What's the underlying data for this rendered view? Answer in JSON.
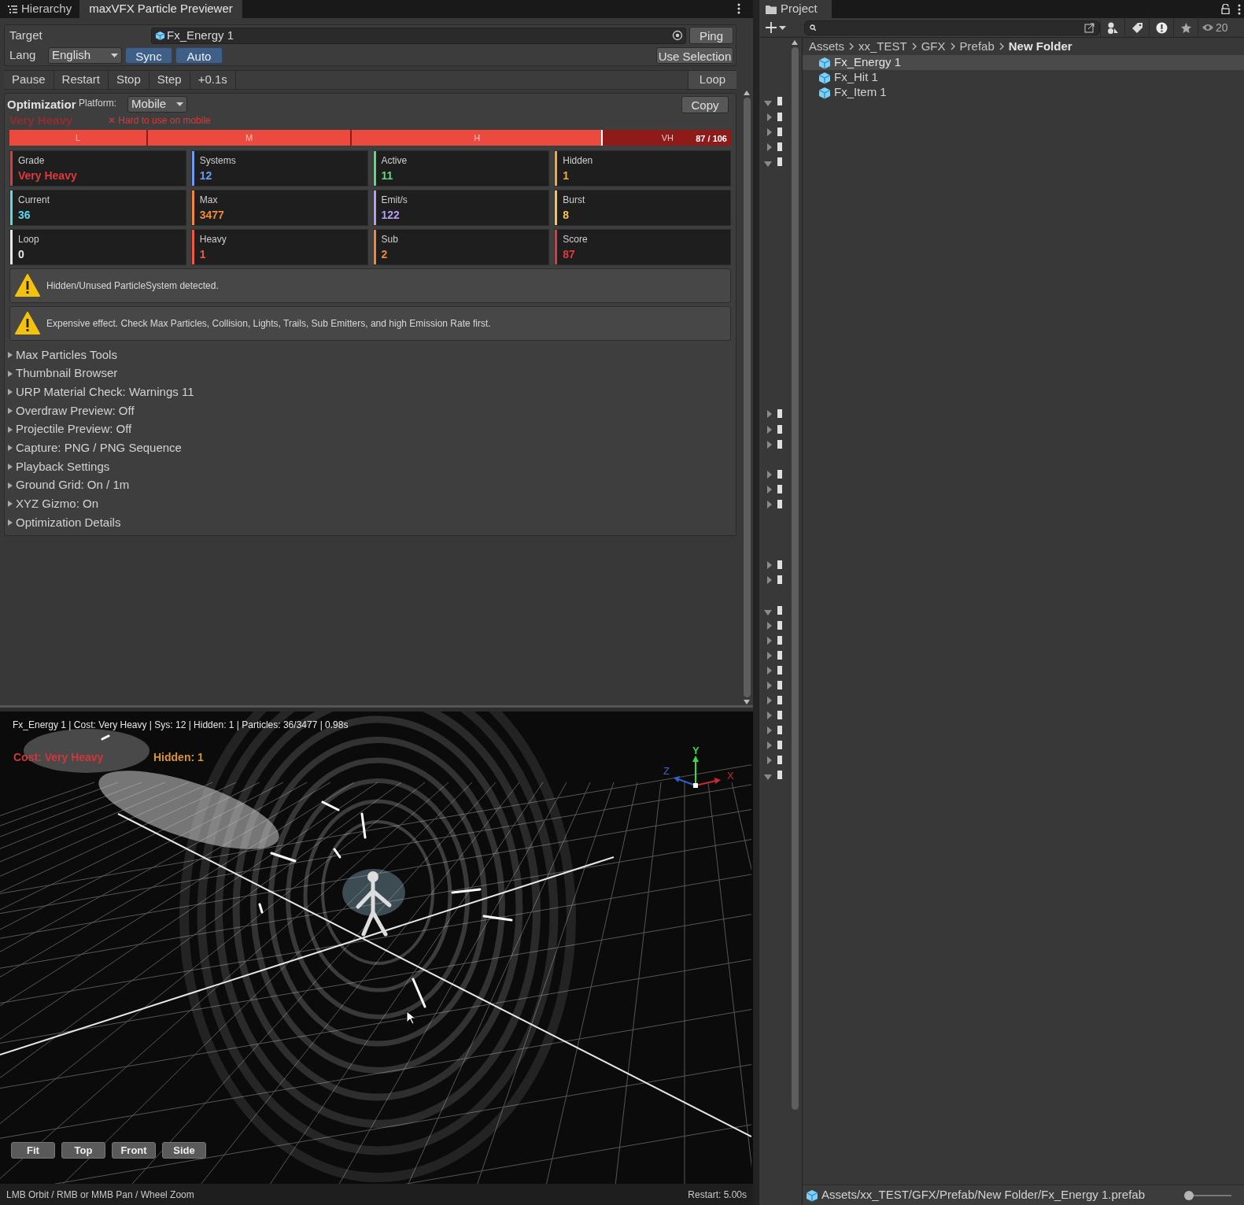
{
  "tabs": [
    {
      "label": "Hierarchy",
      "selected": false,
      "kind": "hierarchy"
    },
    {
      "label": "maxVFX Particle Previewer",
      "selected": true,
      "kind": "plain"
    }
  ],
  "target": {
    "label": "Target",
    "value": "Fx_Energy 1",
    "ping": "Ping"
  },
  "lang": {
    "label": "Lang",
    "value": "English",
    "use_selection": "Use Selection",
    "toggles": [
      {
        "label": "Sync",
        "on": true
      },
      {
        "label": "Auto",
        "on": true
      }
    ]
  },
  "playback": [
    {
      "label": "Pause",
      "kind": "action"
    },
    {
      "label": "Restart",
      "kind": "action"
    },
    {
      "label": "Stop",
      "kind": "action"
    },
    {
      "label": "Step",
      "kind": "action"
    },
    {
      "label": "+0.1s",
      "kind": "action"
    },
    {
      "label": "Loop",
      "kind": "toggle"
    }
  ],
  "optimization": {
    "title": "Optimizatior",
    "platform_label": "Platform:",
    "platform": "Mobile",
    "copy": "Copy",
    "grade": "Very Heavy",
    "verdict": "✕ Hard to use on mobile",
    "scale": {
      "segments": [
        "L",
        "M",
        "H",
        "VH"
      ],
      "level": 0.82,
      "score": "87 / 106"
    },
    "stats": [
      {
        "label": "Grade",
        "value": "Very Heavy",
        "color": "#e0393e"
      },
      {
        "label": "Systems",
        "value": "12",
        "color": "#6e9bf0"
      },
      {
        "label": "Active",
        "value": "11",
        "color": "#5fd97a"
      },
      {
        "label": "Hidden",
        "value": "1",
        "color": "#f0a93a"
      },
      {
        "label": "Current",
        "value": "36",
        "color": "#5ed8e8"
      },
      {
        "label": "Max",
        "value": "3477",
        "color": "#f08a3a"
      },
      {
        "label": "Emit/s",
        "value": "122",
        "color": "#b49cf5"
      },
      {
        "label": "Burst",
        "value": "8",
        "color": "#f5c453"
      },
      {
        "label": "Loop",
        "value": "0",
        "color": "#e6e6e6"
      },
      {
        "label": "Heavy",
        "value": "1",
        "color": "#ef5a3f"
      },
      {
        "label": "Sub",
        "value": "2",
        "color": "#f0853f"
      },
      {
        "label": "Score",
        "value": "87",
        "color": "#e0393e"
      }
    ],
    "warnings": [
      "Hidden/Unused ParticleSystem detected.",
      "Expensive effect. Check Max Particles, Collision, Lights, Trails, Sub Emitters, and high Emission Rate first."
    ]
  },
  "sections": [
    {
      "label": "Max Particles Tools",
      "expanded": false
    },
    {
      "label": "Thumbnail Browser",
      "expanded": false
    },
    {
      "label": "URP Material Check: Warnings 11",
      "expanded": false
    },
    {
      "label": "Overdraw Preview: Off",
      "expanded": false
    },
    {
      "label": "Projectile Preview: Off",
      "expanded": false
    },
    {
      "label": "Capture: PNG / PNG Sequence",
      "expanded": false
    },
    {
      "label": "Playback Settings",
      "expanded": false
    },
    {
      "label": "Ground Grid: On / 1m",
      "expanded": false
    },
    {
      "label": "XYZ Gizmo: On",
      "expanded": false
    },
    {
      "label": "Optimization Details",
      "expanded": false
    }
  ],
  "viewport": {
    "info": "Fx_Energy 1 | Cost: Very Heavy | Sys: 12 | Hidden: 1 | Particles: 36/3477 | 0.98s",
    "cost": "Cost: Very Heavy",
    "hidden": "Hidden: 1",
    "gizmo": {
      "y": "Y",
      "z": "Z",
      "x": "X"
    },
    "views": [
      "Fit",
      "Top",
      "Front",
      "Side"
    ]
  },
  "status_bar": {
    "hint": "LMB Orbit / RMB or MMB Pan / Wheel Zoom",
    "restart": "Restart: 5.00s"
  },
  "project": {
    "tab": "Project",
    "hidden_count": "20",
    "breadcrumb": [
      {
        "label": "Assets",
        "selected": false
      },
      {
        "label": "xx_TEST",
        "selected": false
      },
      {
        "label": "GFX",
        "selected": false
      },
      {
        "label": "Prefab",
        "selected": false
      },
      {
        "label": "New Folder",
        "selected": true
      }
    ],
    "files": [
      {
        "name": "Fx_Energy 1",
        "selected": true
      },
      {
        "name": "Fx_Hit 1",
        "selected": false
      },
      {
        "name": "Fx_Item 1",
        "selected": false
      }
    ],
    "path": "Assets/xx_TEST/GFX/Prefab/New Folder/Fx_Energy 1.prefab",
    "zoom": {
      "level": 0
    }
  }
}
